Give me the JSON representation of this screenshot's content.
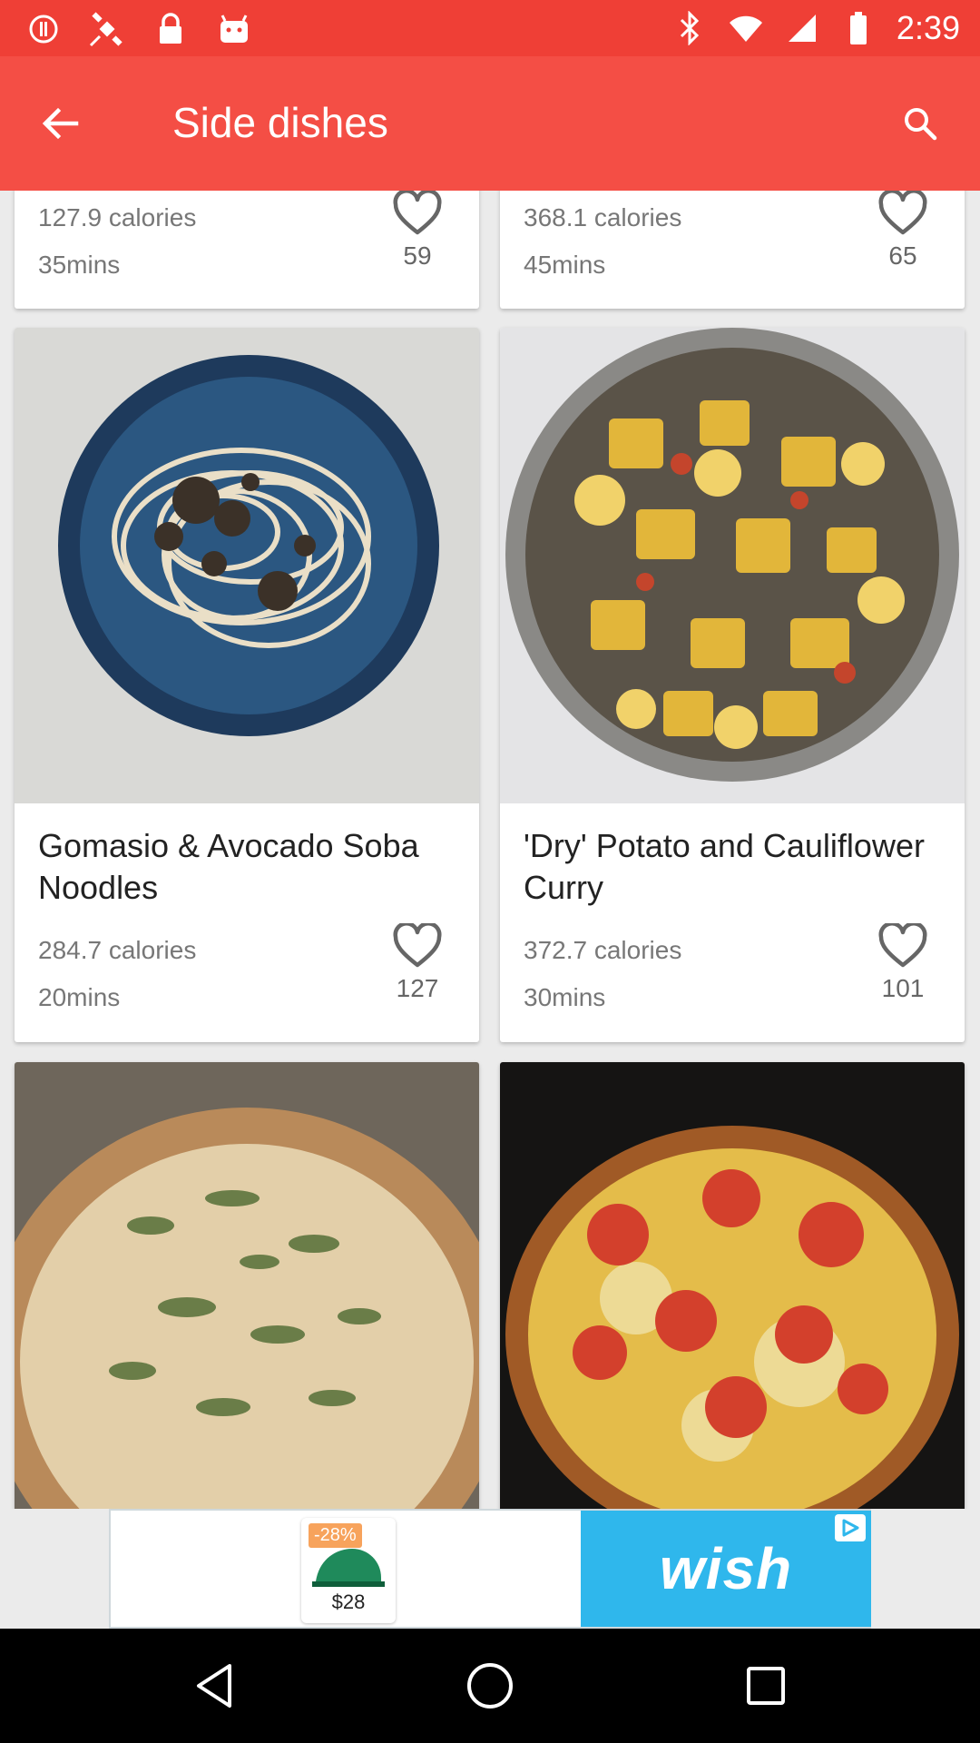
{
  "status_bar": {
    "time": "2:39",
    "left_icons": [
      "alert-icon",
      "satellite-icon",
      "lock-icon",
      "android-icon"
    ],
    "right_icons": [
      "bluetooth-icon",
      "wifi-icon",
      "signal-icon",
      "battery-icon"
    ]
  },
  "app_bar": {
    "title": "Side dishes",
    "back_icon": "arrow-back-icon",
    "search_icon": "search-icon",
    "color": "#f44e45"
  },
  "recipes": [
    {
      "title": "",
      "calories": "127.9 calories",
      "duration": "35mins",
      "likes": "59"
    },
    {
      "title": "",
      "calories": "368.1 calories",
      "duration": "45mins",
      "likes": "65"
    },
    {
      "title": "Gomasio & Avocado Soba Noodles",
      "calories": "284.7 calories",
      "duration": "20mins",
      "likes": "127"
    },
    {
      "title": "'Dry' Potato and Cauliflower Curry",
      "calories": "372.7 calories",
      "duration": "30mins",
      "likes": "101"
    },
    {
      "title": "",
      "calories": "",
      "duration": "",
      "likes": ""
    },
    {
      "title": "",
      "calories": "",
      "duration": "",
      "likes": ""
    }
  ],
  "ad": {
    "discount": "-28%",
    "price": "$28",
    "brand": "wish",
    "brand_color": "#2fb7ec"
  },
  "nav_bar": {
    "icons": [
      "back-triangle-icon",
      "home-circle-icon",
      "recents-square-icon"
    ]
  }
}
